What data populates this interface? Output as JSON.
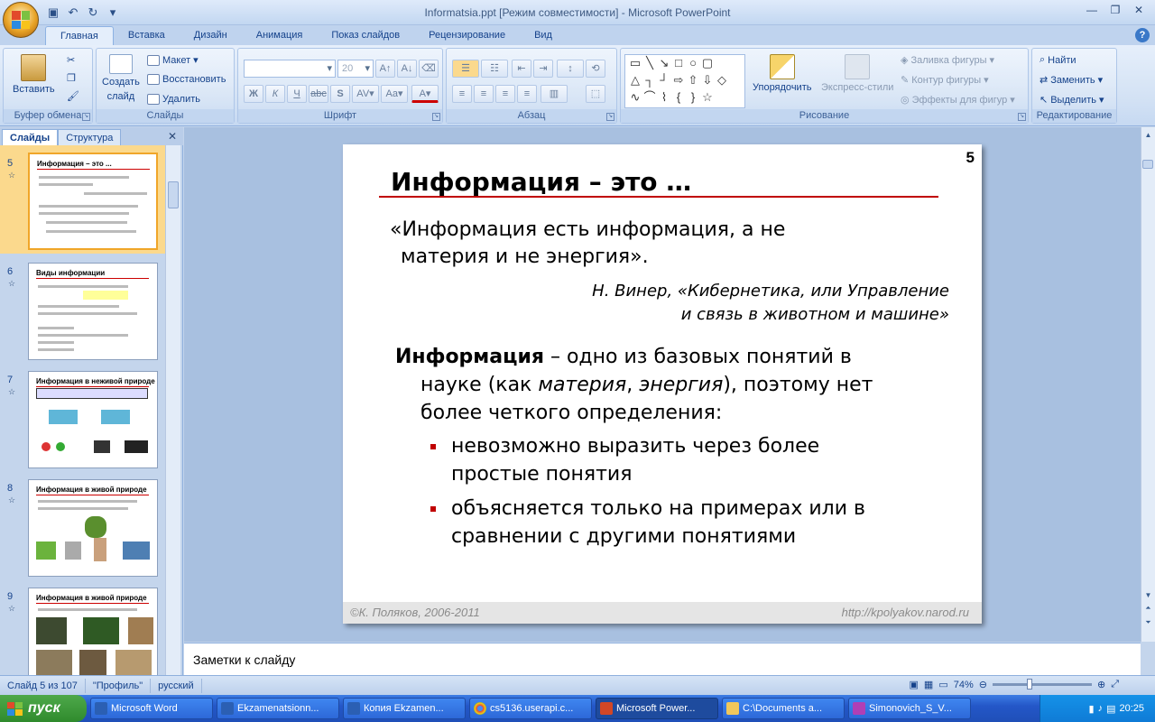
{
  "window": {
    "title": "Informatsia.ppt [Режим совместимости] - Microsoft PowerPoint"
  },
  "tabs": [
    "Главная",
    "Вставка",
    "Дизайн",
    "Анимация",
    "Показ слайдов",
    "Рецензирование",
    "Вид"
  ],
  "ribbon": {
    "clipboard": {
      "label": "Буфер обмена",
      "paste": "Вставить"
    },
    "slides": {
      "label": "Слайды",
      "create": "Создать",
      "create2": "слайд",
      "layout": "Макет",
      "reset": "Восстановить",
      "delete": "Удалить"
    },
    "font": {
      "label": "Шрифт",
      "size": "20",
      "bold": "Ж",
      "italic": "К",
      "underline": "Ч",
      "strike": "abc",
      "shadow": "S"
    },
    "paragraph": {
      "label": "Абзац"
    },
    "drawing": {
      "label": "Рисование",
      "arrange": "Упорядочить",
      "quick_styles": "Экспресс-стили",
      "fill": "Заливка фигуры",
      "outline": "Контур фигуры",
      "effects": "Эффекты для фигур"
    },
    "editing": {
      "label": "Редактирование",
      "find": "Найти",
      "replace": "Заменить",
      "select": "Выделить"
    }
  },
  "left_pane": {
    "tab_slides": "Слайды",
    "tab_outline": "Структура",
    "thumbs": [
      {
        "num": "5",
        "title": "Информация – это ..."
      },
      {
        "num": "6",
        "title": "Виды информации"
      },
      {
        "num": "7",
        "title": "Информация в неживой природе"
      },
      {
        "num": "8",
        "title": "Информация в живой природе"
      },
      {
        "num": "9",
        "title": "Информация в живой природе"
      }
    ]
  },
  "slide": {
    "number": "5",
    "title": "Информация – это …",
    "quote_l1": "«Информация есть информация, а не",
    "quote_l2": "материя и не энергия».",
    "author_l1": "Н. Винер, «Кибернетика, или Управление",
    "author_l2": "и связь в животном и машине»",
    "def_bold": "Информация",
    "def_rest": " – одно из базовых понятий в",
    "def_l2a": "науке (как ",
    "def_l2b": "материя",
    "def_l2c": ", ",
    "def_l2d": "энергия",
    "def_l2e": "), поэтому нет",
    "def_l3": "более четкого определения:",
    "b1_l1": "невозможно выразить через более",
    "b1_l2": "простые понятия",
    "b2_l1": "объясняется только на примерах или в",
    "b2_l2": "сравнении с другими понятиями",
    "footer_left": "©К. Поляков, 2006-2011",
    "footer_right": "http://kpolyakov.narod.ru"
  },
  "notes": {
    "placeholder": "Заметки к слайду"
  },
  "status": {
    "slide": "Слайд 5 из 107",
    "theme": "\"Профиль\"",
    "lang": "русский",
    "zoom": "74%"
  },
  "taskbar": {
    "start": "пуск",
    "items": [
      "Microsoft Word",
      "Ekzamenatsionn...",
      "Копия Ekzamen...",
      "cs5136.userapi.c...",
      "Microsoft Power...",
      "C:\\Documents a...",
      "Simonovich_S_V..."
    ],
    "time": "20:25"
  }
}
